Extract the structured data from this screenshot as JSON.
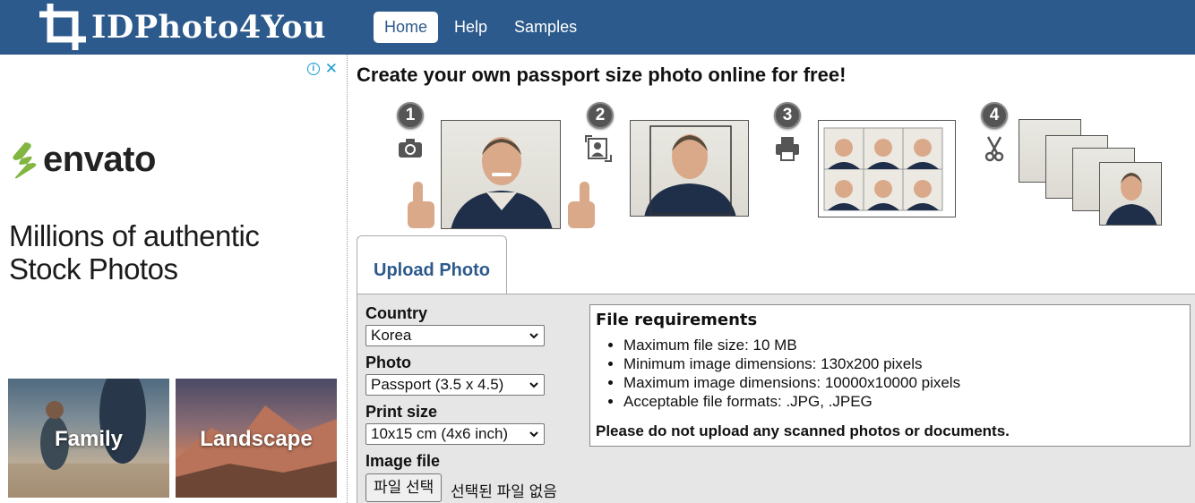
{
  "brand": {
    "name": "IDPhoto4You",
    "logo_icon": "crop-frame-icon"
  },
  "nav": {
    "items": [
      {
        "label": "Home",
        "active": true
      },
      {
        "label": "Help",
        "active": false
      },
      {
        "label": "Samples",
        "active": false
      }
    ]
  },
  "ad": {
    "brand_text": "envato",
    "headline_line1": "Millions of authentic",
    "headline_line2": "Stock Photos",
    "tiles": [
      {
        "label": "Family"
      },
      {
        "label": "Landscape"
      }
    ],
    "info_icon": "info-icon",
    "close_icon": "close-icon",
    "accent": "#82b541"
  },
  "page": {
    "title": "Create your own passport size photo online for free!"
  },
  "steps": [
    {
      "number": "1",
      "icon": "camera-icon"
    },
    {
      "number": "2",
      "icon": "crop-portrait-icon"
    },
    {
      "number": "3",
      "icon": "printer-icon"
    },
    {
      "number": "4",
      "icon": "scissors-icon"
    }
  ],
  "tab": {
    "label": "Upload Photo"
  },
  "form": {
    "country_label": "Country",
    "country_value": "Korea",
    "photo_label": "Photo",
    "photo_value": "Passport (3.5 x 4.5)",
    "print_label": "Print size",
    "print_value": "10x15 cm (4x6 inch)",
    "file_label": "Image file",
    "file_button": "파일 선택",
    "file_status": "선택된 파일 없음"
  },
  "requirements": {
    "title": "File requirements",
    "items": [
      "Maximum file size: 10 MB",
      "Minimum image dimensions: 130x200 pixels",
      "Maximum image dimensions: 10000x10000 pixels",
      "Acceptable file formats: .JPG, .JPEG"
    ],
    "note": "Please do not upload any scanned photos or documents."
  },
  "colors": {
    "header": "#2d5a8c",
    "panel": "#e6e6e6",
    "tab_text": "#2d5a8c"
  }
}
